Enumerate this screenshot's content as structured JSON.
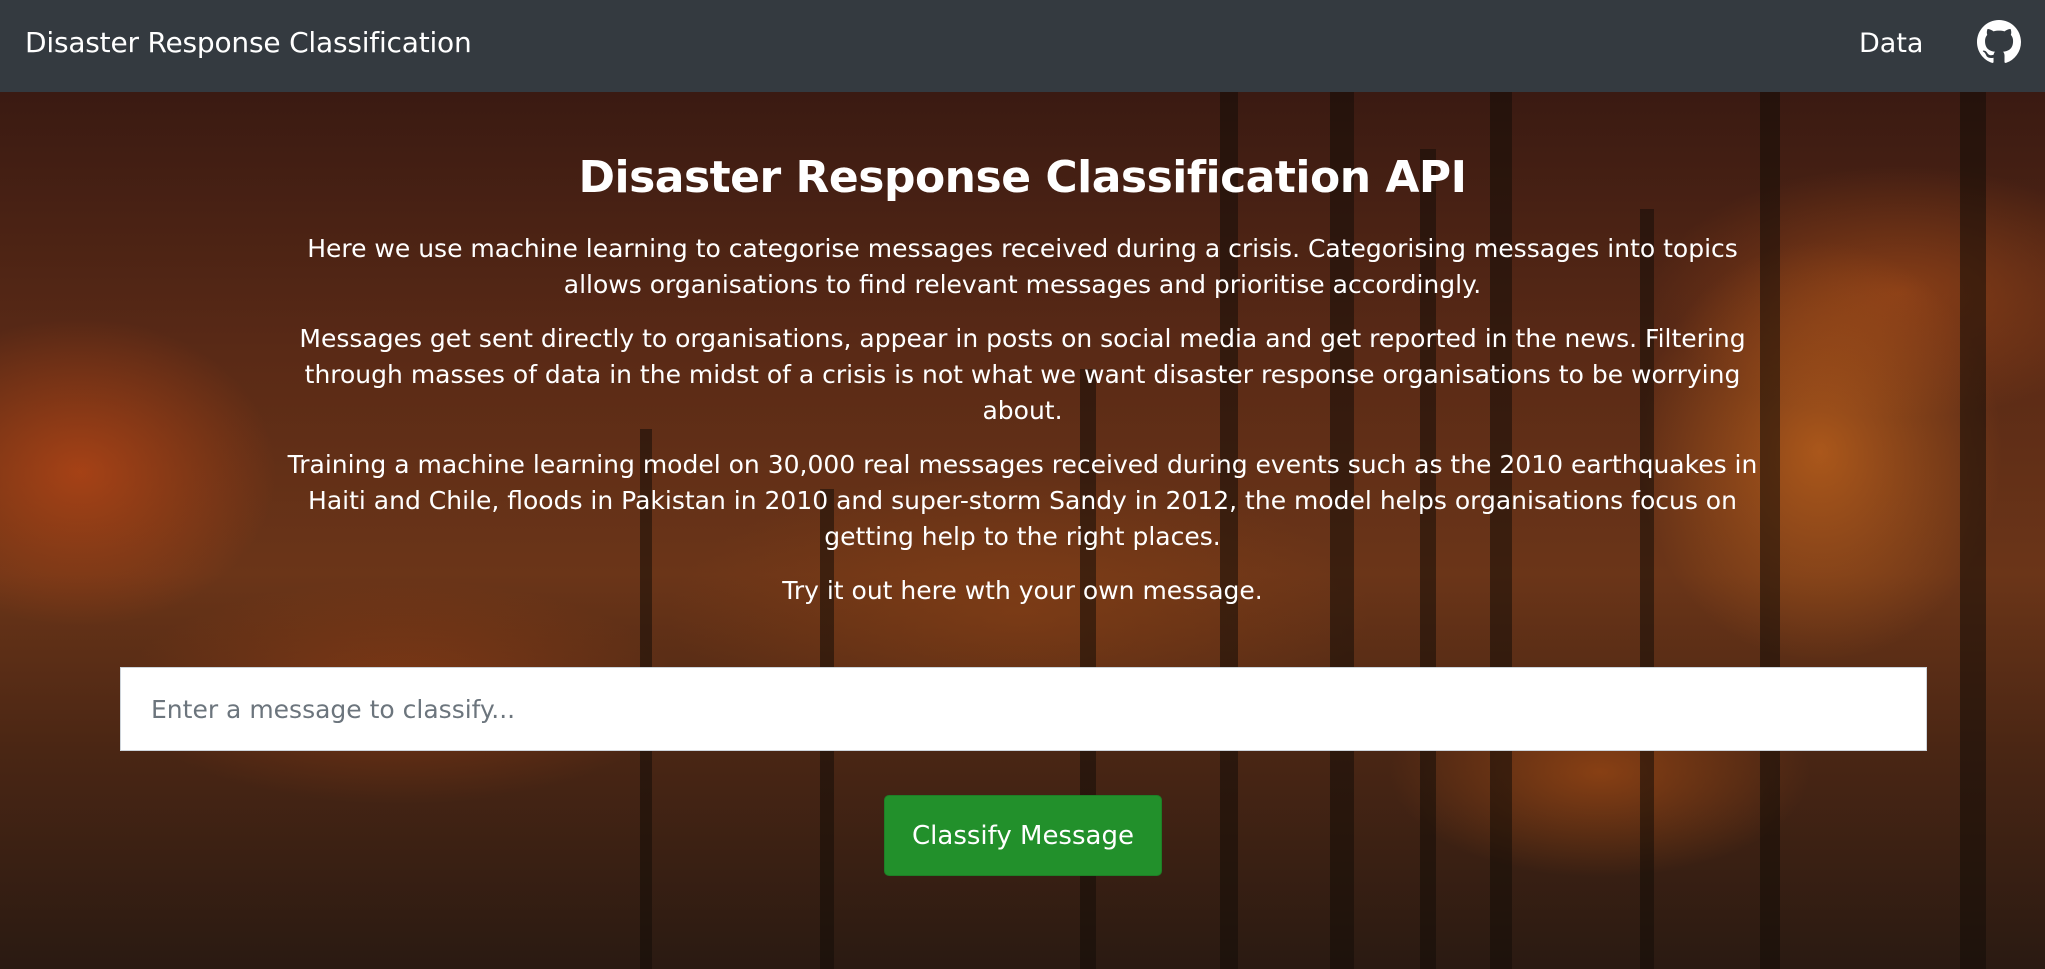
{
  "navbar": {
    "brand": "Disaster Response Classification",
    "data_link": "Data",
    "github_icon": "github-icon"
  },
  "hero": {
    "title": "Disaster Response Classification API",
    "paragraphs": [
      "Here we use machine learning to categorise messages received during a crisis. Categorising messages into topics allows organisations to find relevant messages and prioritise accordingly.",
      "Messages get sent directly to organisations, appear in posts on social media and get reported in the news. Filtering through masses of data in the midst of a crisis is not what we want disaster response organisations to be worrying about.",
      "Training a machine learning model on 30,000 real messages received during events such as the 2010 earthquakes in Haiti and Chile, floods in Pakistan in 2010 and super-storm Sandy in 2012, the model helps organisations focus on getting help to the right places.",
      "Try it out here wth your own message."
    ]
  },
  "form": {
    "message_placeholder": "Enter a message to classify...",
    "message_value": "",
    "classify_label": "Classify Message"
  },
  "colors": {
    "navbar_bg": "#343a40",
    "button_bg": "#22902b"
  }
}
